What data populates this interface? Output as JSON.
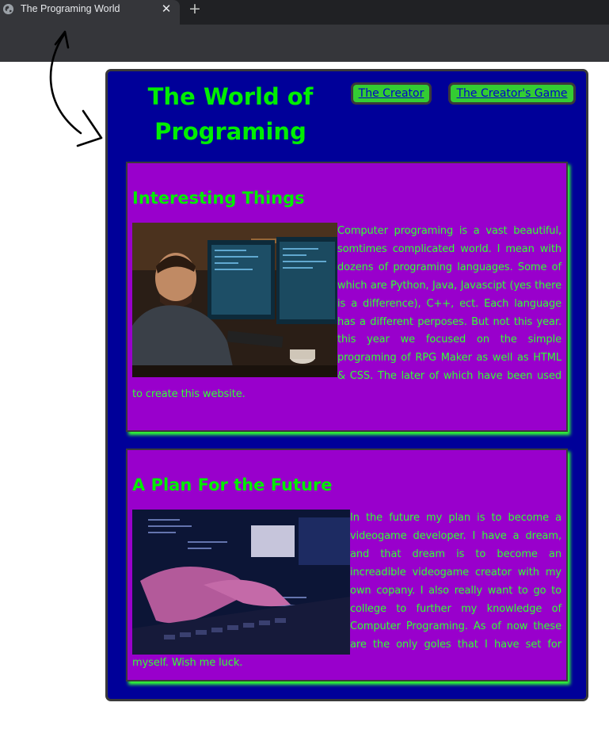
{
  "browser": {
    "tab_title": "The Programing World",
    "tab_close": "✕",
    "new_tab": "+"
  },
  "site": {
    "title": "The World of Programing",
    "nav": {
      "creator": "The Creator",
      "creators_game": "The Creator's Game"
    }
  },
  "sections": [
    {
      "heading": "Interesting Things",
      "image": "man-at-computer-monitors-photo",
      "text": "Computer programing is a vast beautiful, somtimes complicated world. I mean with dozens of programing languages. Some of which are Python, Java, Javascipt (yes there is a difference), C++, ect. Each language has a different perposes. But not this year. this year we focused on the simple programing of RPG Maker as well as HTML & CSS. The later of which have been used to create this website."
    },
    {
      "heading": "A Plan For the Future",
      "image": "hands-typing-on-keyboard-photo",
      "text": "In the future my plan is to become a videogame developer. I have a dream, and that dream is to become an increadible videogame creator with my own copany. I also really want to go to college to further my knowledge of Computer Programing. As of now these are the only goles that I have set for myself. Wish me luck."
    }
  ],
  "colors": {
    "page_bg": "#000099",
    "section_bg": "#9900cc",
    "accent_green": "#00ee00",
    "link_blue": "#0000cc"
  }
}
